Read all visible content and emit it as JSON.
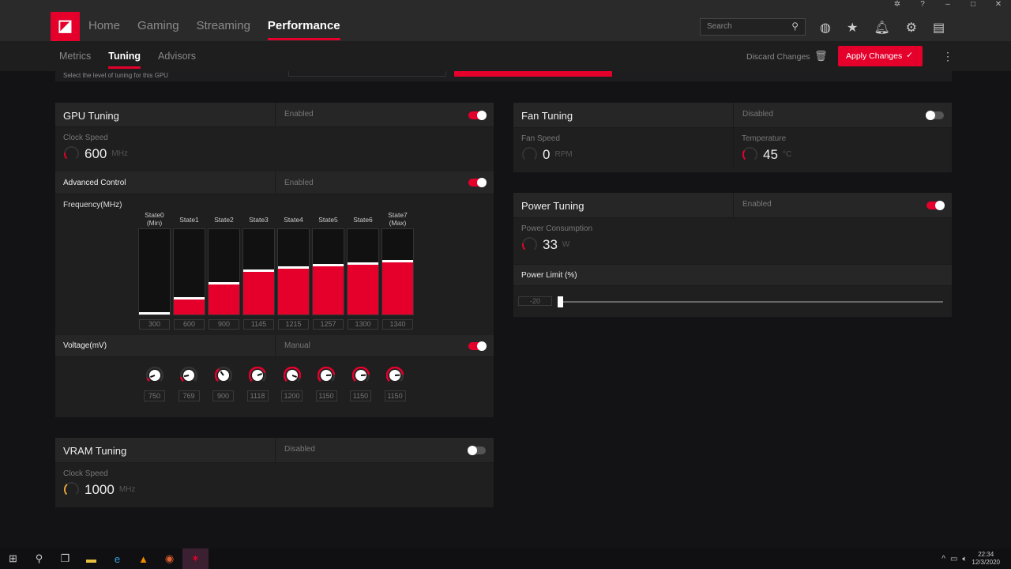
{
  "window": {
    "controls": [
      "bug-icon",
      "help-icon",
      "minimize",
      "maximize",
      "close"
    ]
  },
  "nav": {
    "tabs": [
      "Home",
      "Gaming",
      "Streaming",
      "Performance"
    ],
    "active": "Performance"
  },
  "search": {
    "placeholder": "Search"
  },
  "subnav": {
    "tabs": [
      "Metrics",
      "Tuning",
      "Advisors"
    ],
    "active": "Tuning",
    "discard": "Discard Changes",
    "apply": "Apply Changes"
  },
  "cutoff_text": "Select the level of tuning for this GPU",
  "gpu": {
    "title": "GPU Tuning",
    "status": "Enabled",
    "enabled": true,
    "clock_label": "Clock Speed",
    "clock_value": "600",
    "clock_unit": "MHz",
    "advanced_label": "Advanced Control",
    "advanced_status": "Enabled",
    "advanced_enabled": true,
    "freq_label": "Frequency(MHz)",
    "states": [
      {
        "name": "State0",
        "sub": "(Min)",
        "freq": 300,
        "mv": 750
      },
      {
        "name": "State1",
        "sub": "",
        "freq": 600,
        "mv": 769
      },
      {
        "name": "State2",
        "sub": "",
        "freq": 900,
        "mv": 900
      },
      {
        "name": "State3",
        "sub": "",
        "freq": 1145,
        "mv": 1118
      },
      {
        "name": "State4",
        "sub": "",
        "freq": 1215,
        "mv": 1200
      },
      {
        "name": "State5",
        "sub": "",
        "freq": 1257,
        "mv": 1150
      },
      {
        "name": "State6",
        "sub": "",
        "freq": 1300,
        "mv": 1150
      },
      {
        "name": "State7",
        "sub": "(Max)",
        "freq": 1340,
        "mv": 1150
      }
    ],
    "voltage_label": "Voltage(mV)",
    "voltage_status": "Manual",
    "voltage_enabled": true
  },
  "vram": {
    "title": "VRAM Tuning",
    "status": "Disabled",
    "enabled": false,
    "clock_label": "Clock Speed",
    "clock_value": "1000",
    "clock_unit": "MHz"
  },
  "fan": {
    "title": "Fan Tuning",
    "status": "Disabled",
    "enabled": false,
    "speed_label": "Fan Speed",
    "speed_value": "0",
    "speed_unit": "RPM",
    "temp_label": "Temperature",
    "temp_value": "45",
    "temp_unit": "°C"
  },
  "power": {
    "title": "Power Tuning",
    "status": "Enabled",
    "enabled": true,
    "consumption_label": "Power Consumption",
    "consumption_value": "33",
    "consumption_unit": "W",
    "limit_label": "Power Limit (%)",
    "limit_value": "-20"
  },
  "taskbar": {
    "time": "22:34",
    "date": "12/3/2020"
  },
  "colors": {
    "accent": "#e4002b",
    "vram_gauge": "#e8a33a"
  }
}
